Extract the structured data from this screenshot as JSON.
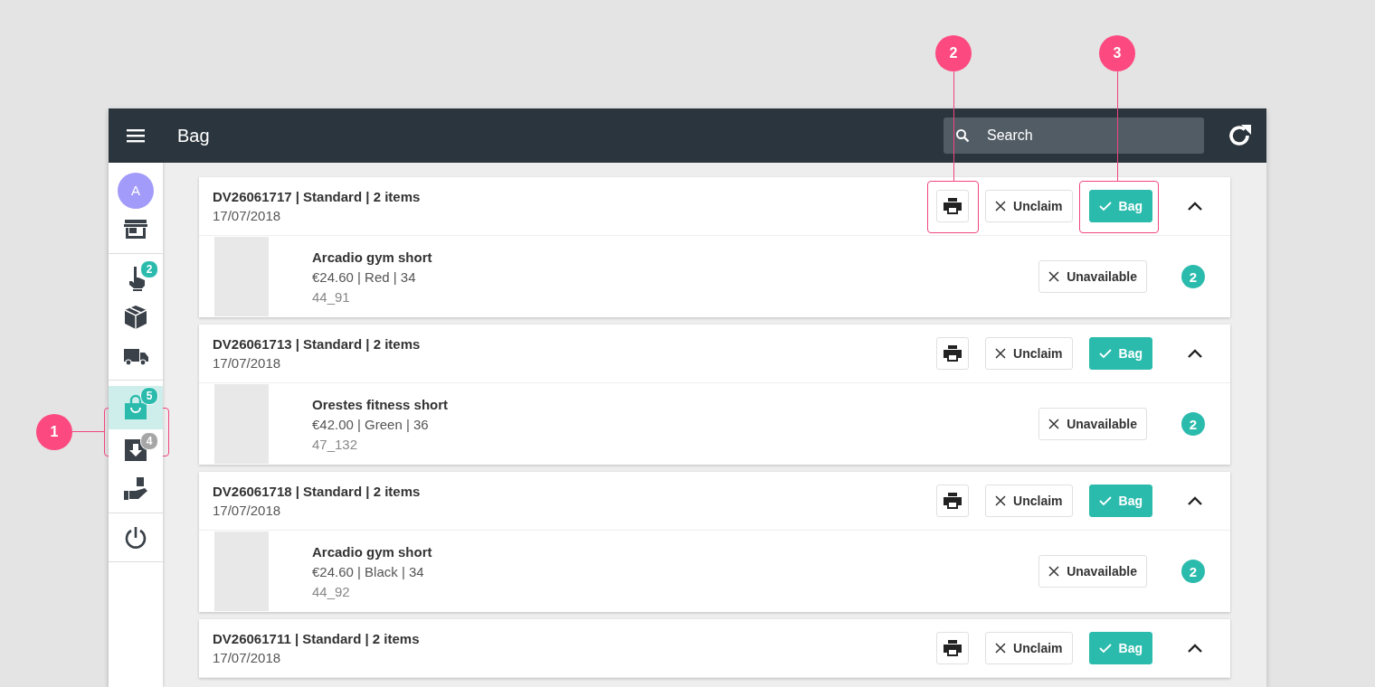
{
  "topbar": {
    "title": "Bag",
    "search": {
      "placeholder": "Search"
    }
  },
  "sidebar": {
    "groups": [
      [
        {
          "kind": "avatar",
          "label": "A",
          "selected": false
        },
        {
          "kind": "store",
          "selected": false
        }
      ],
      [
        {
          "kind": "hand",
          "selected": false,
          "badge": {
            "count": "2",
            "color": "#2bbbad"
          }
        },
        {
          "kind": "box",
          "selected": false
        },
        {
          "kind": "truck",
          "selected": false
        }
      ],
      [
        {
          "kind": "bag",
          "selected": true,
          "badge": {
            "count": "5",
            "color": "#2bbbad"
          }
        },
        {
          "kind": "download",
          "selected": false,
          "badge": {
            "count": "4",
            "color": "#a6a6a6"
          }
        },
        {
          "kind": "handbag",
          "selected": false
        }
      ],
      [
        {
          "kind": "power",
          "selected": false
        }
      ]
    ]
  },
  "orders": [
    {
      "title": "DV26061717 | Standard | 2 items",
      "date": "17/07/2018",
      "unclaim": "Unclaim",
      "bag": "Bag",
      "expanded": true,
      "items": [
        {
          "name": "Arcadio gym short",
          "details": "€24.60 | Red | 34",
          "sku": "44_91",
          "unavailable": "Unavailable",
          "quantity": "2"
        }
      ]
    },
    {
      "title": "DV26061713 | Standard | 2 items",
      "date": "17/07/2018",
      "unclaim": "Unclaim",
      "bag": "Bag",
      "expanded": true,
      "items": [
        {
          "name": "Orestes fitness short",
          "details": "€42.00 | Green | 36",
          "sku": "47_132",
          "unavailable": "Unavailable",
          "quantity": "2"
        }
      ]
    },
    {
      "title": "DV26061718 | Standard | 2 items",
      "date": "17/07/2018",
      "unclaim": "Unclaim",
      "bag": "Bag",
      "expanded": true,
      "items": [
        {
          "name": "Arcadio gym short",
          "details": "€24.60 | Black | 34",
          "sku": "44_92",
          "unavailable": "Unavailable",
          "quantity": "2"
        }
      ]
    },
    {
      "title": "DV26061711 | Standard | 2 items",
      "date": "17/07/2018",
      "unclaim": "Unclaim",
      "bag": "Bag",
      "expanded": true
    }
  ],
  "callouts": [
    {
      "number": "1"
    },
    {
      "number": "2"
    },
    {
      "number": "3"
    }
  ]
}
